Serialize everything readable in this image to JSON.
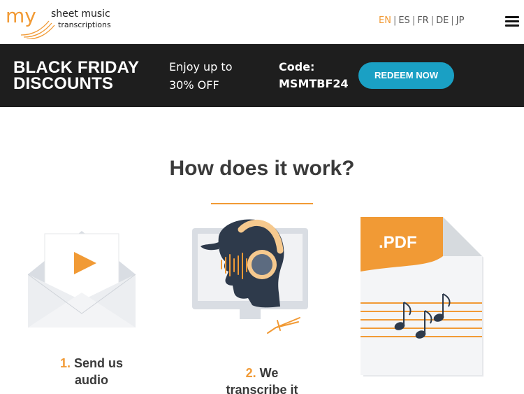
{
  "header": {
    "logo": {
      "mark": "my",
      "line1": "sheet music",
      "line2": "transcriptions"
    },
    "languages": [
      "EN",
      "ES",
      "FR",
      "DE",
      "JP"
    ],
    "active_language": "EN",
    "menu_icon": "hamburger-icon"
  },
  "banner": {
    "title_line1": "BLACK FRIDAY",
    "title_line2": "DISCOUNTS",
    "offer_line1": "Enjoy up to",
    "offer_line2": "30% OFF",
    "code_label": "Code:",
    "code_value": "MSMTBF24",
    "cta_label": "REDEEM NOW"
  },
  "how": {
    "title": "How does it work?",
    "steps": [
      {
        "number": "1.",
        "text_line1": "Send us",
        "text_line2": "audio",
        "icon": "envelope-play-icon"
      },
      {
        "number": "2.",
        "text_line1": "We",
        "text_line2": "transcribe it",
        "icon": "headphones-listener-icon"
      },
      {
        "number": "",
        "text_line1": "",
        "text_line2": "",
        "icon": "pdf-sheet-music-icon",
        "badge": ".PDF"
      }
    ]
  },
  "colors": {
    "accent": "#f19a35",
    "banner_bg": "#1e1e1e",
    "cta": "#1aa0c4",
    "text": "#3a3a3a"
  }
}
